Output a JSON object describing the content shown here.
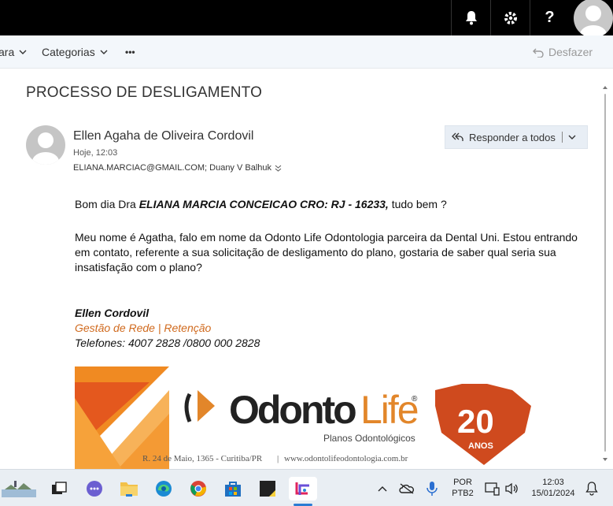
{
  "topbar": {
    "icons": [
      "bell-icon",
      "gear-icon",
      "help-icon",
      "user-avatar"
    ],
    "help_label": "?"
  },
  "toolbar": {
    "partial_label": "ara",
    "categories_label": "Categorias",
    "more_label": "•••",
    "undo_label": "Desfazer"
  },
  "message": {
    "subject": "PROCESSO DE DESLIGAMENTO",
    "sender_name": "Ellen Agaha de Oliveira Cordovil",
    "sent_time": "Hoje, 12:03",
    "recipients": "ELIANA.MARCIAC@GMAIL.COM; Duany V Balhuk",
    "reply_all_label": "Responder a todos",
    "greeting_prefix": "Bom dia Dra ",
    "greeting_bold": "ELIANA MARCIA CONCEICAO CRO: RJ - 16233,",
    "greeting_suffix": " tudo bem ?",
    "paragraph": "Meu nome é Agatha, falo em nome da Odonto Life Odontologia parceira da Dental Uni. Estou entrando em contato, referente a sua solicitação de desligamento do plano, gostaria de saber qual seria sua insatisfação com o plano?",
    "signature": {
      "name": "Ellen Cordovil",
      "role": "Gestão de Rede | Retenção",
      "phones": "Telefones: 4007 2828 /0800 000 2828"
    },
    "banner": {
      "brand_part1": "Odonto",
      "brand_part2": "Life",
      "registered": "®",
      "tagline": "Planos Odontológicos",
      "address": "R. 24 de Maio, 1365 - Curitiba/PR",
      "separator": "|",
      "website": "www.odontolifeodontologia.com.br",
      "badge_number": "20",
      "badge_text": "ANOS"
    }
  },
  "taskbar": {
    "language_top": "POR",
    "language_bottom": "PTB2",
    "clock_time": "12:03",
    "clock_date": "15/01/2024"
  },
  "colors": {
    "accent_orange": "#d06a1e",
    "banner_orange": "#f08a22",
    "badge_red": "#cf4a1e",
    "topbar": "#000000"
  }
}
